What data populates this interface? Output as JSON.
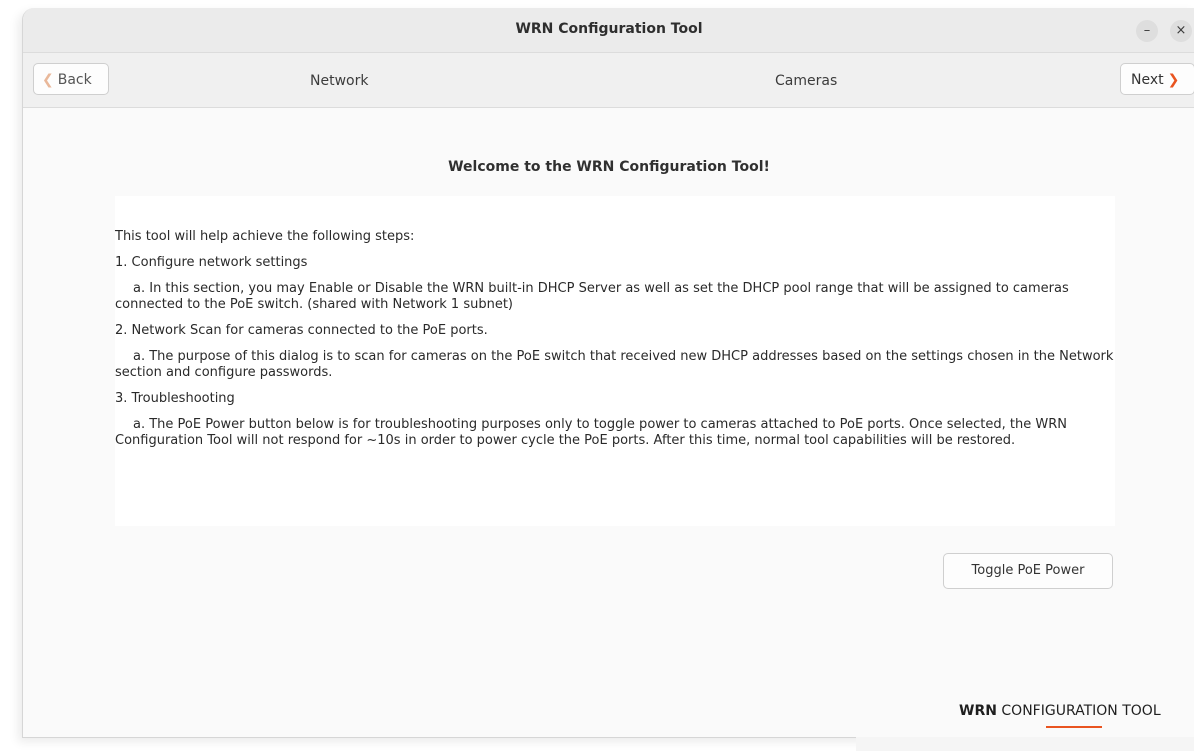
{
  "window": {
    "title": "WRN Configuration Tool",
    "minimize_icon": "–",
    "close_icon": "×"
  },
  "nav": {
    "back_label": "Back",
    "back_chevron": "❮",
    "tab_network": "Network",
    "tab_cameras": "Cameras",
    "next_label": "Next",
    "next_chevron": "❯"
  },
  "main": {
    "welcome": "Welcome to the WRN Configuration Tool!",
    "intro": "This tool will help achieve the following steps:",
    "steps": [
      {
        "title": "1.  Configure network settings",
        "detail": "a.  In this section, you may Enable or Disable the WRN built-in DHCP Server as well as set the DHCP pool range that will be assigned to cameras connected to the PoE switch. (shared with Network 1 subnet)"
      },
      {
        "title": "2.  Network Scan for cameras connected to the PoE ports.",
        "detail": "a.  The purpose of this dialog is to scan for cameras on the PoE switch that received new DHCP addresses based on the settings chosen in the Network section and configure passwords."
      },
      {
        "title": "3.  Troubleshooting",
        "detail": "a.  The PoE Power button below is for troubleshooting purposes only to toggle power to cameras attached to PoE ports.  Once selected, the WRN Configuration Tool will not respond for ~10s in order to power cycle the PoE ports.  After this time, normal tool capabilities will be restored."
      }
    ],
    "toggle_button": "Toggle PoE Power"
  },
  "brand": {
    "bold": "WRN",
    "rest": " CONFIGURATION TOOL",
    "accent": "#e95420"
  }
}
